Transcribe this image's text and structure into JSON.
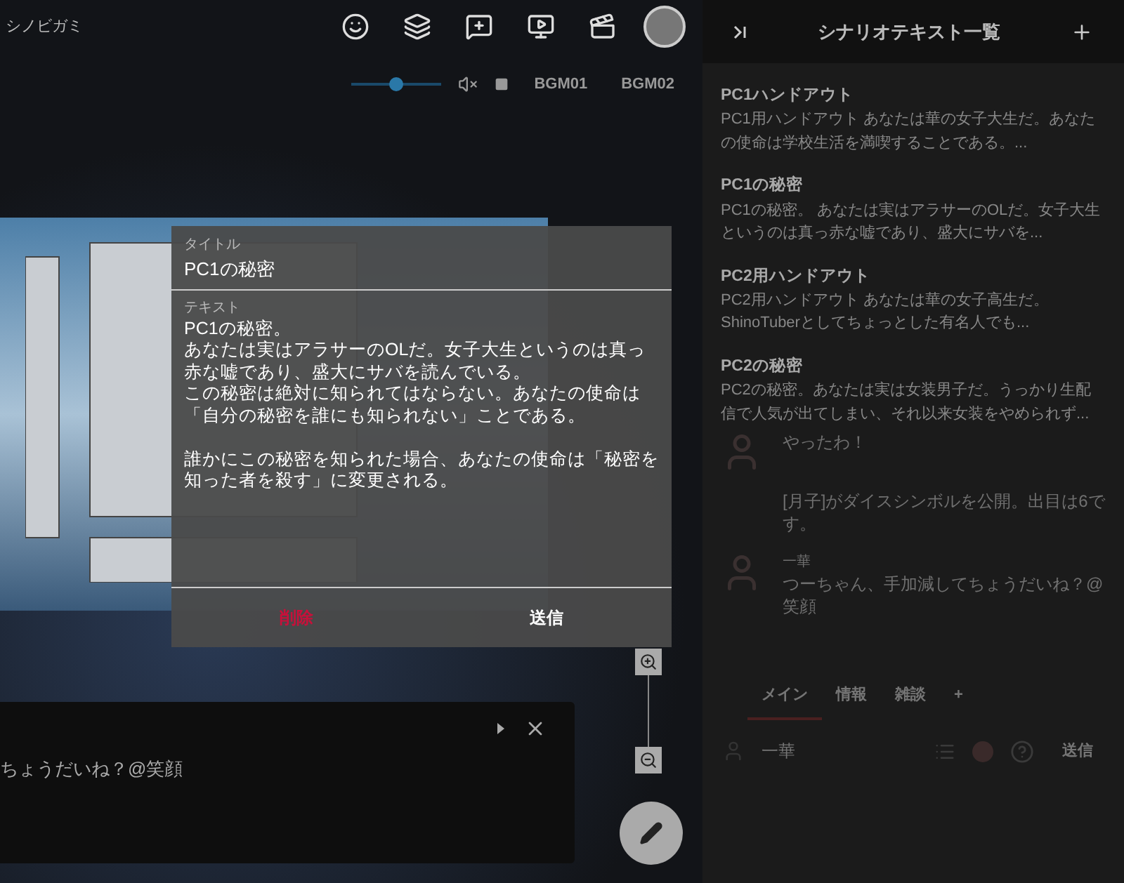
{
  "topbar": {
    "title": "シノビガミ",
    "volume": {
      "level": 0.5,
      "muted": true
    },
    "bgm": [
      "BGM01",
      "BGM02"
    ]
  },
  "dialog": {
    "title_label": "タイトル",
    "title_value": "PC1の秘密",
    "text_label": "テキスト",
    "text_paragraphs": [
      [
        "PC1の秘密。",
        "あなたは実はアラサーのOLだ。女子大生というのは真っ赤な嘘であり、盛大にサバを読んでいる。",
        "この秘密は絶対に知られてはならない。あなたの使命は「自分の秘密を誰にも知られない」ことである。"
      ],
      [
        "誰かにこの秘密を知られた場合、あなたの使命は「秘密を知った者を殺す」に変更される。"
      ]
    ],
    "buttons": [
      {
        "label": "削除",
        "kind": "danger"
      },
      {
        "label": "送信",
        "kind": "primary"
      }
    ]
  },
  "chat_window": {
    "message": "ちょうだいね？@笑顔"
  },
  "side_panel": {
    "title": "シナリオテキスト一覧",
    "items": [
      {
        "title": "PC1ハンドアウト",
        "preview": "PC1用ハンドアウト あなたは華の女子大生だ。あなたの使命は学校生活を満喫することである。..."
      },
      {
        "title": "PC1の秘密",
        "preview": "PC1の秘密。 あなたは実はアラサーのOLだ。女子大生というのは真っ赤な嘘であり、盛大にサバを..."
      },
      {
        "title": "PC2用ハンドアウト",
        "preview": "PC2用ハンドアウト あなたは華の女子高生だ。ShinoTuberとしてちょっとした有名人でも..."
      },
      {
        "title": "PC2の秘密",
        "preview": "PC2の秘密。あなたは実は女装男子だ。うっかり生配信で人気が出てしまい、それ以来女装をやめられず..."
      }
    ],
    "log": [
      {
        "kind": "avatar",
        "text": "やったわ！"
      },
      {
        "kind": "system",
        "text": "[月子]がダイスシンボルを公開。出目は6です。"
      },
      {
        "kind": "avatar",
        "name": "一華",
        "text": "つーちゃん、手加減してちょうだいね？@笑顔"
      }
    ],
    "tabs": [
      {
        "label": "メイン",
        "selected": true
      },
      {
        "label": "情報",
        "selected": false
      },
      {
        "label": "雑談",
        "selected": false
      },
      {
        "label": "+",
        "selected": false
      }
    ],
    "input": {
      "name": "一華",
      "send": "送信"
    }
  }
}
